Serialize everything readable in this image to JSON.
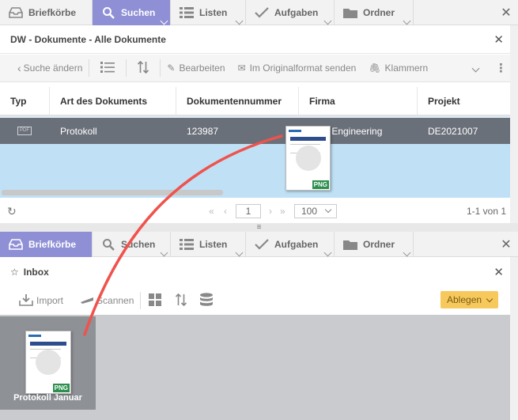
{
  "nav": {
    "items": [
      {
        "label": "Briefkörbe",
        "icon": "tray-icon"
      },
      {
        "label": "Suchen",
        "icon": "search-icon"
      },
      {
        "label": "Listen",
        "icon": "list-icon"
      },
      {
        "label": "Aufgaben",
        "icon": "check-icon"
      },
      {
        "label": "Ordner",
        "icon": "folder-icon"
      }
    ],
    "close": "✕"
  },
  "search_panel": {
    "title": "DW - Dokumente - Alle Dokumente",
    "close": "✕",
    "toolbar": {
      "back": "Suche ändern",
      "edit": "Bearbeiten",
      "send": "Im Originalformat senden",
      "clip": "Klammern"
    },
    "columns": [
      "Typ",
      "Art des Dokuments",
      "Dokumentennummer",
      "Firma",
      "Projekt"
    ],
    "rows": [
      {
        "typ": "PDF",
        "art": "Protokoll",
        "nummer": "123987",
        "firma": "s Engineering",
        "projekt": "DE2021007"
      }
    ],
    "pager": {
      "page": "1",
      "size": "100",
      "range": "1-1 von 1"
    }
  },
  "inbox_panel": {
    "title": "Inbox",
    "close": "✕",
    "toolbar": {
      "import": "Import",
      "scan": "Scannen",
      "ablegen": "Ablegen"
    },
    "tile": {
      "label": "Protokoll Januar",
      "badge": "PNG"
    }
  },
  "drag_ghost": {
    "badge": "PNG"
  },
  "colors": {
    "accent": "#8f8fd6",
    "selected_row": "#6a7079",
    "grid_blank": "#bfe0f5",
    "ablegen": "#f7c95d",
    "arrow": "#f0524c",
    "png_badge": "#2d8f4e"
  }
}
